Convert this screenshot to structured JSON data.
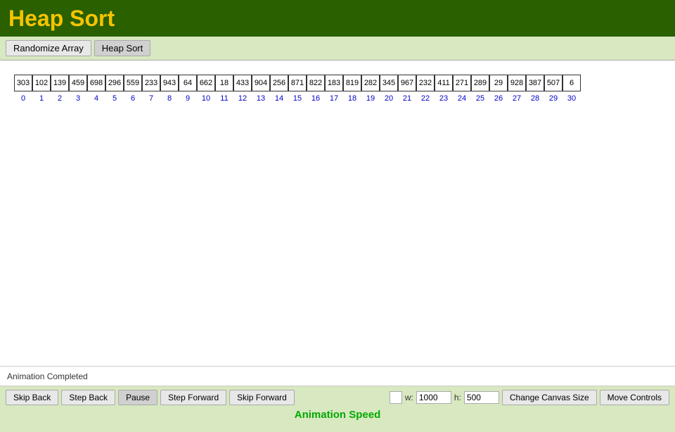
{
  "header": {
    "title": "Heap Sort"
  },
  "toolbar": {
    "randomize_label": "Randomize Array",
    "heapsort_label": "Heap Sort"
  },
  "array": {
    "values": [
      303,
      102,
      139,
      459,
      698,
      296,
      559,
      233,
      943,
      64,
      662,
      18,
      433,
      904,
      256,
      871,
      822,
      183,
      819,
      282,
      345,
      967,
      232,
      411,
      271,
      289,
      29,
      928,
      387,
      507,
      6
    ],
    "indices": [
      0,
      1,
      2,
      3,
      4,
      5,
      6,
      7,
      8,
      9,
      10,
      11,
      12,
      13,
      14,
      15,
      16,
      17,
      18,
      19,
      20,
      21,
      22,
      23,
      24,
      25,
      26,
      27,
      28,
      29,
      30
    ]
  },
  "status": {
    "text": "Animation Completed"
  },
  "bottom": {
    "skip_back": "Skip Back",
    "step_back": "Step Back",
    "pause": "Pause",
    "step_forward": "Step Forward",
    "skip_forward": "Skip Forward",
    "w_label": "w:",
    "w_value": "1000",
    "h_label": "h:",
    "h_value": "500",
    "change_canvas": "Change Canvas Size",
    "move_controls": "Move Controls",
    "animation_speed": "Animation Speed"
  }
}
